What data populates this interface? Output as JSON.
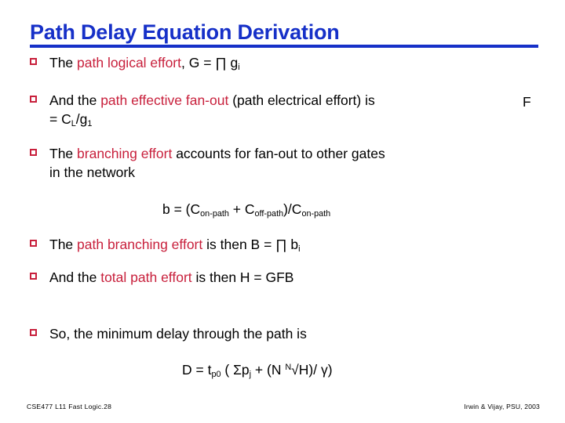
{
  "slide": {
    "title": "Path Delay Equation Derivation",
    "accent_color": "#1630C8",
    "highlight_color": "#C8203C",
    "background_color": "#FFFFFF"
  },
  "bullets": [
    {
      "id": "path-logical-effort",
      "prefix": "The ",
      "highlight": "path logical effort",
      "suffix": ", G = ∏ g",
      "suffix_sub": "i",
      "suffix_tail": ""
    },
    {
      "id": "path-effective-fan-out",
      "prefix": "And the ",
      "highlight": "path effective fan-out",
      "suffix": " (path electrical effort) is",
      "trailing_token": "F",
      "line2_prefix": "= C",
      "line2_sub1": "L",
      "line2_mid": "/g",
      "line2_sub2": "1"
    },
    {
      "id": "branching-effort",
      "prefix": "The ",
      "highlight": "branching effort",
      "suffix": " accounts for fan-out to other gates",
      "line2": "in the network"
    },
    {
      "id": "path-branching-effort",
      "prefix": "The ",
      "highlight": "path branching effort",
      "suffix": " is then B = ∏ b",
      "suffix_sub": "i"
    },
    {
      "id": "total-path-effort",
      "prefix": "And the ",
      "highlight": "total path effort",
      "suffix": " is then H = GFB"
    },
    {
      "id": "minimum-delay",
      "prefix": "So, the minimum delay through the path is",
      "highlight": "",
      "suffix": ""
    }
  ],
  "equations": {
    "branching": {
      "p1": "b = (C",
      "s1": "on-path",
      "p2": " + C",
      "s2": "off-path",
      "p3": ")/C",
      "s3": "on-path"
    },
    "delay": {
      "p1": "D = t",
      "s1": "p0",
      "p2": " ( Σp",
      "s2": "j",
      "p3": " + (N ",
      "root_index": "N",
      "root_symbol": "√",
      "root_radicand": "H",
      "p4": ")/ γ)"
    }
  },
  "footer": {
    "left": "CSE477  L11 Fast Logic.28",
    "right": "Irwin & Vijay, PSU, 2003"
  }
}
